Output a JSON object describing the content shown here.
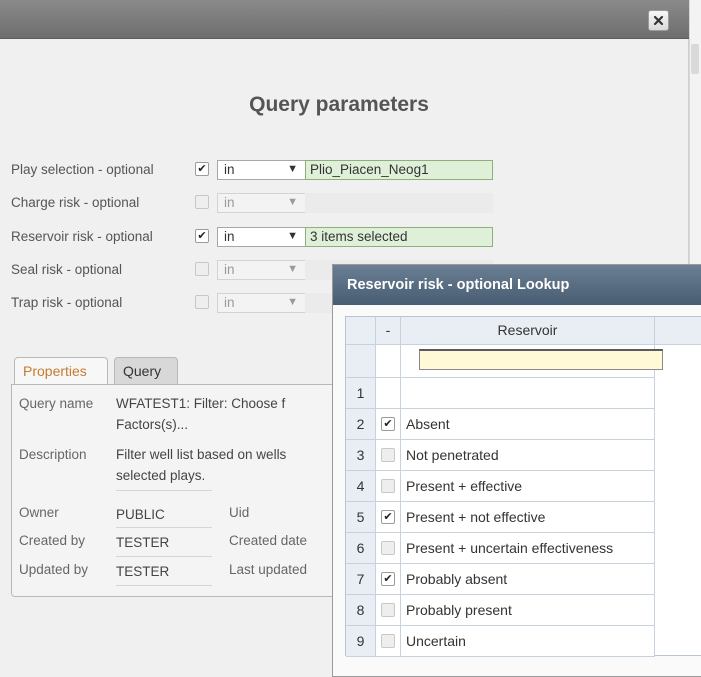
{
  "dialog": {
    "title": "Query parameters",
    "close_icon": "close-icon",
    "params": [
      {
        "label": "Play selection - optional",
        "checked": true,
        "operator": "in",
        "value": "Plio_Piacen_Neog1",
        "enabled": true
      },
      {
        "label": "Charge risk - optional",
        "checked": false,
        "operator": "in",
        "value": "",
        "enabled": false
      },
      {
        "label": "Reservoir risk - optional",
        "checked": true,
        "operator": "in",
        "value": "3 items selected",
        "enabled": true
      },
      {
        "label": "Seal risk - optional",
        "checked": false,
        "operator": "in",
        "value": "",
        "enabled": false
      },
      {
        "label": "Trap risk - optional",
        "checked": false,
        "operator": "in",
        "value": "",
        "enabled": false
      }
    ]
  },
  "tabs": [
    {
      "label": "Properties",
      "active": true
    },
    {
      "label": "Query",
      "active": false
    }
  ],
  "properties": {
    "query_name_label": "Query name",
    "query_name_value_1": "WFATEST1: Filter: Choose f",
    "query_name_value_2": "Factors(s)...",
    "description_label": "Description",
    "description_value_1": "Filter well list based on wells",
    "description_value_2": "selected plays.",
    "owner_label": "Owner",
    "owner_value": "PUBLIC",
    "uid_label": "Uid",
    "created_by_label": "Created by",
    "created_by_value": "TESTER",
    "created_date_label": "Created date",
    "updated_by_label": "Updated by",
    "updated_by_value": "TESTER",
    "last_updated_label": "Last updated"
  },
  "lookup": {
    "title": "Reservoir risk - optional Lookup",
    "header_check": "-",
    "header_column": "Reservoir",
    "filter_value": "",
    "rows": [
      {
        "num": "1",
        "checked": false,
        "value": "",
        "show_check": false
      },
      {
        "num": "2",
        "checked": true,
        "value": "Absent",
        "show_check": true
      },
      {
        "num": "3",
        "checked": false,
        "value": "Not penetrated",
        "show_check": true
      },
      {
        "num": "4",
        "checked": false,
        "value": "Present + effective",
        "show_check": true
      },
      {
        "num": "5",
        "checked": true,
        "value": "Present + not effective",
        "show_check": true
      },
      {
        "num": "6",
        "checked": false,
        "value": "Present + uncertain effectiveness",
        "show_check": true
      },
      {
        "num": "7",
        "checked": true,
        "value": "Probably absent",
        "show_check": true
      },
      {
        "num": "8",
        "checked": false,
        "value": "Probably present",
        "show_check": true
      },
      {
        "num": "9",
        "checked": false,
        "value": "Uncertain",
        "show_check": true
      }
    ]
  },
  "colors": {
    "titlebar": "#7a7a7a",
    "lookup_titlebar": "#576c81",
    "value_highlight": "#dff0d8",
    "active_tab_text": "#c77b2d"
  }
}
